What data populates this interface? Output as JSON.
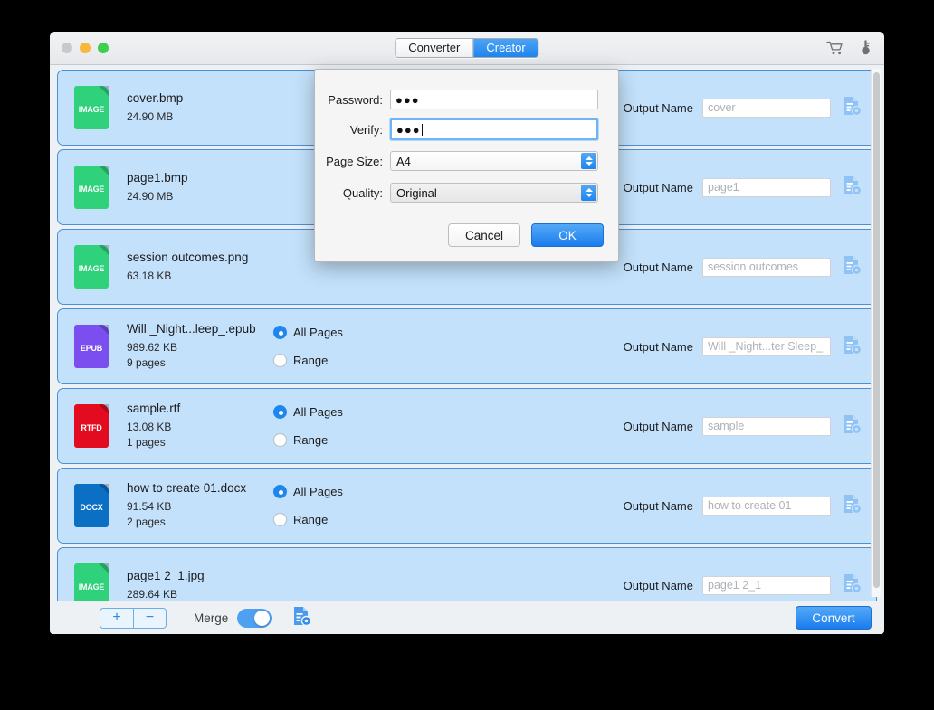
{
  "window": {
    "traffic_lights": [
      "close",
      "minimize",
      "maximize"
    ],
    "tabs": [
      {
        "label": "Converter",
        "active": false
      },
      {
        "label": "Creator",
        "active": true
      }
    ],
    "titlebar_icons": [
      "cart-icon",
      "key-icon"
    ]
  },
  "files": [
    {
      "name": "cover.bmp",
      "size": "24.90 MB",
      "pages": "",
      "type": "IMAGE",
      "color": "#2fd17a",
      "has_radios": false,
      "output_label": "Output Name",
      "output_placeholder": "cover",
      "output_value": ""
    },
    {
      "name": "page1.bmp",
      "size": "24.90 MB",
      "pages": "",
      "type": "IMAGE",
      "color": "#2fd17a",
      "has_radios": false,
      "output_label": "Output Name",
      "output_placeholder": "page1",
      "output_value": ""
    },
    {
      "name": "session outcomes.png",
      "size": "63.18 KB",
      "pages": "",
      "type": "IMAGE",
      "color": "#2fd17a",
      "has_radios": false,
      "output_label": "Output Name",
      "output_placeholder": "session outcomes",
      "output_value": ""
    },
    {
      "name": "Will _Night...leep_.epub",
      "size": "989.62 KB",
      "pages": "9 pages",
      "type": "EPUB",
      "color": "#7b4ef0",
      "has_radios": true,
      "radio_all_label": "All Pages",
      "radio_range_label": "Range",
      "radio_selected": "all",
      "output_label": "Output Name",
      "output_placeholder": "Will _Night...ter Sleep_",
      "output_value": ""
    },
    {
      "name": "sample.rtf",
      "size": "13.08 KB",
      "pages": "1 pages",
      "type": "RTFD",
      "color": "#e30b20",
      "has_radios": true,
      "radio_all_label": "All Pages",
      "radio_range_label": "Range",
      "radio_selected": "all",
      "output_label": "Output Name",
      "output_placeholder": "sample",
      "output_value": ""
    },
    {
      "name": "how to create 01.docx",
      "size": "91.54 KB",
      "pages": "2 pages",
      "type": "DOCX",
      "color": "#0b6fc4",
      "has_radios": true,
      "radio_all_label": "All Pages",
      "radio_range_label": "Range",
      "radio_selected": "all",
      "output_label": "Output Name",
      "output_placeholder": "how to create 01",
      "output_value": ""
    },
    {
      "name": "page1 2_1.jpg",
      "size": "289.64 KB",
      "pages": "",
      "type": "IMAGE",
      "color": "#2fd17a",
      "has_radios": false,
      "output_label": "Output Name",
      "output_placeholder": "page1 2_1",
      "output_value": ""
    }
  ],
  "bottom_bar": {
    "add_label": "+",
    "remove_label": "−",
    "merge_label": "Merge",
    "merge_on": true,
    "settings_icon": "document-settings-icon",
    "convert_label": "Convert"
  },
  "dialog": {
    "password_label": "Password:",
    "password_value": "●●●",
    "verify_label": "Verify:",
    "verify_value": "●●●",
    "page_size_label": "Page Size:",
    "page_size_value": "A4",
    "quality_label": "Quality:",
    "quality_value": "Original",
    "cancel_label": "Cancel",
    "ok_label": "OK"
  },
  "colors": {
    "accent": "#1f86f0",
    "row_bg": "#c3e1fb",
    "row_border": "#4a90d9",
    "window_bg": "#eef1f4"
  }
}
